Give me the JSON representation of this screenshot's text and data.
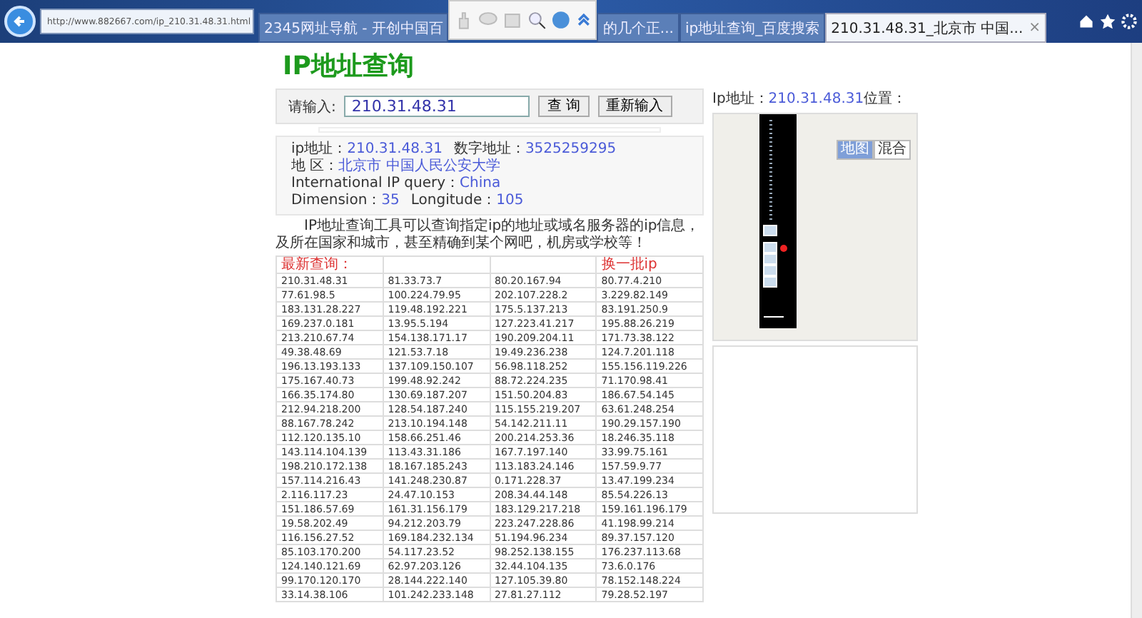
{
  "browser": {
    "address": "http://www.882667.com/ip_210.31.48.31.html",
    "tabs": [
      {
        "label": "2345网址导航 - 开创中国百",
        "selected": false
      },
      {
        "label": "的几个正...",
        "selected": false
      },
      {
        "label": "ip地址查询_百度搜索",
        "selected": false
      },
      {
        "label": "210.31.48.31_北京市 中国...",
        "selected": true,
        "close": "×"
      }
    ]
  },
  "title": "IP地址查询",
  "query": {
    "label": "请输入:",
    "value": "210.31.48.31",
    "buttons": [
      "查 询",
      "重新输入"
    ]
  },
  "info": [
    [
      {
        "label": "ip地址：",
        "value": "210.31.48.31"
      },
      {
        "label": "数字地址：",
        "value": "3525259295"
      }
    ],
    [
      {
        "label": "地 区：",
        "value": "北京市 中国人民公安大学"
      }
    ],
    [
      {
        "label": "International IP query：",
        "value": "China"
      }
    ],
    [
      {
        "label": "Dimension：",
        "value": "35"
      },
      {
        "label": "Longitude：",
        "value": "105"
      }
    ]
  ],
  "description": "IP地址查询工具可以查询指定ip的地址或域名服务器的ip信息，及所在国家和城市，甚至精确到某个网吧，机房或学校等！",
  "table": {
    "header_left": "最新查询：",
    "header_right": "换一批ip",
    "rows": [
      [
        "210.31.48.31",
        "81.33.73.7",
        "80.20.167.94",
        "80.77.4.210"
      ],
      [
        "77.61.98.5",
        "100.224.79.95",
        "202.107.228.2",
        "3.229.82.149"
      ],
      [
        "183.131.28.227",
        "119.48.192.221",
        "175.5.137.213",
        "83.191.250.9"
      ],
      [
        "169.237.0.181",
        "13.95.5.194",
        "127.223.41.217",
        "195.88.26.219"
      ],
      [
        "213.210.67.74",
        "154.138.171.17",
        "190.209.204.11",
        "171.73.38.122"
      ],
      [
        "49.38.48.69",
        "121.53.7.18",
        "19.49.236.238",
        "124.7.201.118"
      ],
      [
        "196.13.193.133",
        "137.109.150.107",
        "56.98.118.252",
        "155.156.119.226"
      ],
      [
        "175.167.40.73",
        "199.48.92.242",
        "88.72.224.235",
        "71.170.98.41"
      ],
      [
        "166.35.174.80",
        "130.69.187.207",
        "151.50.204.83",
        "186.67.54.145"
      ],
      [
        "212.94.218.200",
        "128.54.187.240",
        "115.155.219.207",
        "63.61.248.254"
      ],
      [
        "88.167.78.242",
        "213.10.194.148",
        "54.142.211.11",
        "190.29.157.190"
      ],
      [
        "112.120.135.10",
        "158.66.251.46",
        "200.214.253.36",
        "18.246.35.118"
      ],
      [
        "143.114.104.139",
        "113.43.31.186",
        "167.7.197.140",
        "33.99.75.161"
      ],
      [
        "198.210.172.138",
        "18.167.185.243",
        "113.183.24.146",
        "157.59.9.77"
      ],
      [
        "157.114.216.43",
        "141.248.230.87",
        "0.171.228.37",
        "13.47.199.234"
      ],
      [
        "2.116.117.23",
        "24.47.10.153",
        "208.34.44.148",
        "85.54.226.13"
      ],
      [
        "151.186.57.69",
        "161.31.156.179",
        "183.129.217.218",
        "159.161.196.179"
      ],
      [
        "19.58.202.49",
        "94.212.203.79",
        "223.247.228.86",
        "41.198.99.214"
      ],
      [
        "116.156.27.52",
        "169.184.232.134",
        "51.194.96.234",
        "89.37.157.120"
      ],
      [
        "85.103.170.200",
        "54.117.23.52",
        "98.252.138.155",
        "176.237.113.68"
      ],
      [
        "124.140.121.69",
        "62.97.203.126",
        "32.44.104.135",
        "73.6.0.176"
      ],
      [
        "99.170.120.170",
        "28.144.222.140",
        "127.105.39.80",
        "78.152.148.224"
      ],
      [
        "33.14.38.106",
        "101.242.233.148",
        "27.81.27.112",
        "79.28.52.197"
      ]
    ]
  },
  "map": {
    "caption_label": "Ip地址：",
    "caption_ip": "210.31.48.31",
    "caption_suffix": "位置：",
    "modes": [
      {
        "label": "地图",
        "selected": true
      },
      {
        "label": "混合",
        "selected": false
      }
    ]
  }
}
